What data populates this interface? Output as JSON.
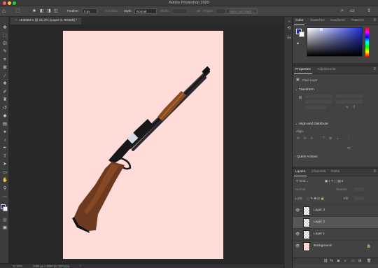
{
  "app": {
    "window_title": "Adobe Photoshop 2020"
  },
  "options_bar": {
    "feather_label": "Feather:",
    "feather_value": "0 px",
    "anti_alias_label": "Anti-alias",
    "style_label": "Style:",
    "style_value": "Normal",
    "width_label": "Width:",
    "height_label": "Height:",
    "select_mask_label": "Select and Mask..."
  },
  "document": {
    "tab_label": "Untitled-1 @ 21.3% (Layer 2, RGB/8) *",
    "close_glyph": "×"
  },
  "status_bar": {
    "zoom": "21.32%",
    "doc_info": "3480 px x 4928 px (300 ppi)"
  },
  "colors": {
    "canvas_background": "#ffdcd8",
    "foreground_swatch": "#1f2b8f",
    "background_swatch": "#ffffff",
    "workspace": "#282828"
  },
  "color_panel": {
    "tabs": [
      "Color",
      "Swatches",
      "Gradients",
      "Patterns"
    ],
    "active_tab": "Color"
  },
  "properties_panel": {
    "tabs": [
      "Properties",
      "Adjustments"
    ],
    "active_tab": "Properties",
    "layer_kind": "Pixel Layer",
    "transform_header": "Transform",
    "align_header": "Align and Distribute",
    "align_label": "Align:",
    "quick_actions_header": "Quick Actions",
    "more_glyph": "•••"
  },
  "layers_panel": {
    "tabs": [
      "Layers",
      "Channels",
      "Paths"
    ],
    "active_tab": "Layers",
    "filter_kind": "Kind",
    "blend_mode": "Normal",
    "opacity_label": "Opacity:",
    "lock_label": "Lock:",
    "fill_label": "Fill:",
    "layers": [
      {
        "name": "Layer 3",
        "selected": false,
        "thumb": "transparent",
        "locked": false
      },
      {
        "name": "Layer 2",
        "selected": true,
        "thumb": "transparent",
        "locked": false
      },
      {
        "name": "Layer 1",
        "selected": false,
        "thumb": "transparent",
        "locked": false
      },
      {
        "name": "Background",
        "selected": false,
        "thumb": "pink",
        "locked": true
      }
    ]
  }
}
